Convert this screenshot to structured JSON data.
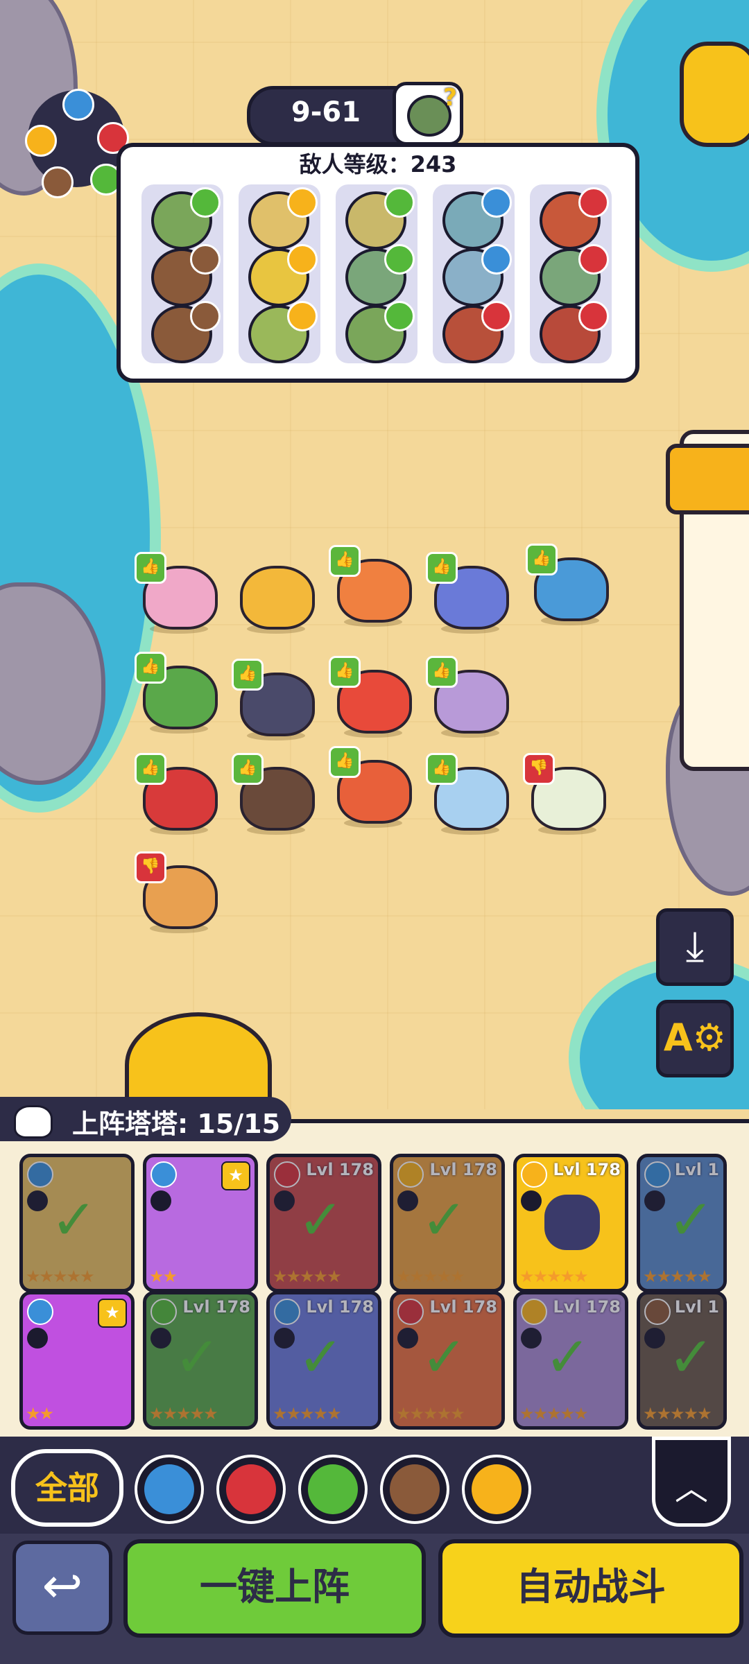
{
  "stage": {
    "label": "9-61"
  },
  "enemy_panel": {
    "title": "敌人等级：243"
  },
  "roster": {
    "title": "上阵塔塔: 15/15"
  },
  "cards": [
    {
      "level": "",
      "stars": "★★★★★"
    },
    {
      "level": "",
      "stars": "★★"
    },
    {
      "level": "Lvl 178",
      "stars": "★★★★★"
    },
    {
      "level": "Lvl 178",
      "stars": "★★★★★"
    },
    {
      "level": "Lvl 178",
      "stars": "★★★★★"
    },
    {
      "level": "Lvl 1",
      "stars": "★★★★★"
    },
    {
      "level": "",
      "stars": "★★"
    },
    {
      "level": "Lvl 178",
      "stars": "★★★★★"
    },
    {
      "level": "Lvl 178",
      "stars": "★★★★★"
    },
    {
      "level": "Lvl 178",
      "stars": "★★★★★"
    },
    {
      "level": "Lvl 178",
      "stars": "★★★★★"
    },
    {
      "level": "Lvl 1",
      "stars": "★★★★★"
    }
  ],
  "filters": {
    "all_label": "全部"
  },
  "actions": {
    "deploy_label": "一键上阵",
    "auto_label": "自动战斗"
  },
  "colors": {
    "water": "#3a8fd8",
    "fire": "#d8343b",
    "grass": "#54b83a",
    "earth": "#8a5a3a",
    "thunder": "#f7b21b"
  }
}
